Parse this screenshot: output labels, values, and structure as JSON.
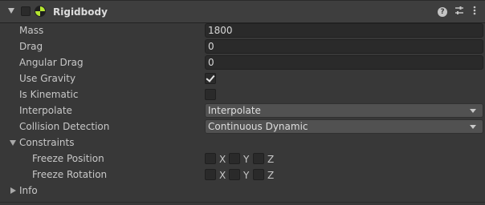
{
  "component": {
    "title": "Rigidbody",
    "icons": [
      "foldout-expanded-icon",
      "rigidbody-icon",
      "help-icon",
      "preset-icon",
      "context-menu-icon"
    ]
  },
  "properties": {
    "mass": {
      "label": "Mass",
      "value": "1800"
    },
    "drag": {
      "label": "Drag",
      "value": "0"
    },
    "angular_drag": {
      "label": "Angular Drag",
      "value": "0"
    },
    "use_gravity": {
      "label": "Use Gravity",
      "checked": true
    },
    "is_kinematic": {
      "label": "Is Kinematic",
      "checked": false
    },
    "interpolate": {
      "label": "Interpolate",
      "value": "Interpolate"
    },
    "collision_detection": {
      "label": "Collision Detection",
      "value": "Continuous Dynamic"
    }
  },
  "constraints": {
    "label": "Constraints",
    "freeze_position": {
      "label": "Freeze Position",
      "axes": [
        "X",
        "Y",
        "Z"
      ]
    },
    "freeze_rotation": {
      "label": "Freeze Rotation",
      "axes": [
        "X",
        "Y",
        "Z"
      ]
    }
  },
  "info": {
    "label": "Info"
  },
  "colors": {
    "background": "#383838",
    "header": "#3e3e3e",
    "field": "#2a2a2a",
    "dropdown": "#515151",
    "text": "#d2d2d2"
  }
}
